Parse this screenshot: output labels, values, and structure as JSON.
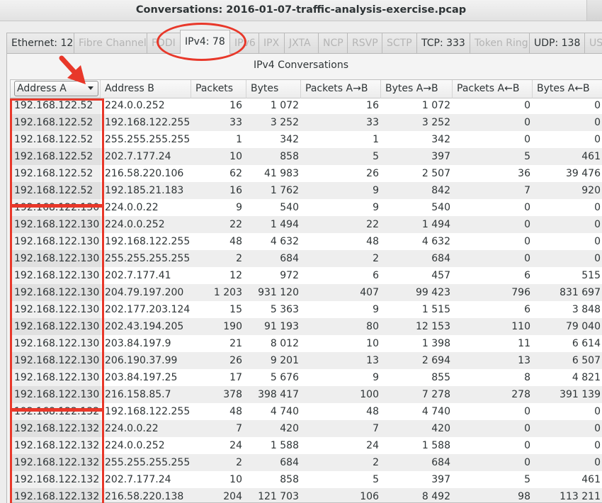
{
  "window": {
    "title": "Conversations: 2016-01-07-traffic-analysis-exercise.pcap"
  },
  "tabs": [
    {
      "label": "Ethernet: 12",
      "state": "enabled"
    },
    {
      "label": "Fibre Channel",
      "state": "disabled"
    },
    {
      "label": "FDDI",
      "state": "disabled"
    },
    {
      "label": "IPv4: 78",
      "state": "active"
    },
    {
      "label": "IPv6",
      "state": "disabled"
    },
    {
      "label": "IPX",
      "state": "disabled"
    },
    {
      "label": "JXTA",
      "state": "disabled"
    },
    {
      "label": "NCP",
      "state": "disabled"
    },
    {
      "label": "RSVP",
      "state": "disabled"
    },
    {
      "label": "SCTP",
      "state": "disabled"
    },
    {
      "label": "TCP: 333",
      "state": "enabled"
    },
    {
      "label": "Token Ring",
      "state": "disabled"
    },
    {
      "label": "UDP: 138",
      "state": "enabled"
    },
    {
      "label": "USB",
      "state": "disabled"
    }
  ],
  "section_title": "IPv4 Conversations",
  "columns": [
    "Address A",
    "Address B",
    "Packets",
    "Bytes",
    "Packets A→B",
    "Bytes A→B",
    "Packets A←B",
    "Bytes A←B"
  ],
  "rows": [
    [
      "192.168.122.52",
      "224.0.0.252",
      "16",
      "1 072",
      "16",
      "1 072",
      "0",
      "0"
    ],
    [
      "192.168.122.52",
      "192.168.122.255",
      "33",
      "3 252",
      "33",
      "3 252",
      "0",
      "0"
    ],
    [
      "192.168.122.52",
      "255.255.255.255",
      "1",
      "342",
      "1",
      "342",
      "0",
      "0"
    ],
    [
      "192.168.122.52",
      "202.7.177.24",
      "10",
      "858",
      "5",
      "397",
      "5",
      "461"
    ],
    [
      "192.168.122.52",
      "216.58.220.106",
      "62",
      "41 983",
      "26",
      "2 507",
      "36",
      "39 476"
    ],
    [
      "192.168.122.52",
      "192.185.21.183",
      "16",
      "1 762",
      "9",
      "842",
      "7",
      "920"
    ],
    [
      "192.168.122.130",
      "224.0.0.22",
      "9",
      "540",
      "9",
      "540",
      "0",
      "0"
    ],
    [
      "192.168.122.130",
      "224.0.0.252",
      "22",
      "1 494",
      "22",
      "1 494",
      "0",
      "0"
    ],
    [
      "192.168.122.130",
      "192.168.122.255",
      "48",
      "4 632",
      "48",
      "4 632",
      "0",
      "0"
    ],
    [
      "192.168.122.130",
      "255.255.255.255",
      "2",
      "684",
      "2",
      "684",
      "0",
      "0"
    ],
    [
      "192.168.122.130",
      "202.7.177.41",
      "12",
      "972",
      "6",
      "457",
      "6",
      "515"
    ],
    [
      "192.168.122.130",
      "204.79.197.200",
      "1 203",
      "931 120",
      "407",
      "99 423",
      "796",
      "831 697"
    ],
    [
      "192.168.122.130",
      "202.177.203.124",
      "15",
      "5 363",
      "9",
      "1 515",
      "6",
      "3 848"
    ],
    [
      "192.168.122.130",
      "202.43.194.205",
      "190",
      "91 193",
      "80",
      "12 153",
      "110",
      "79 040"
    ],
    [
      "192.168.122.130",
      "203.84.197.9",
      "21",
      "8 012",
      "10",
      "1 398",
      "11",
      "6 614"
    ],
    [
      "192.168.122.130",
      "206.190.37.99",
      "26",
      "9 201",
      "13",
      "2 694",
      "13",
      "6 507"
    ],
    [
      "192.168.122.130",
      "203.84.197.25",
      "17",
      "5 676",
      "9",
      "855",
      "8",
      "4 821"
    ],
    [
      "192.168.122.130",
      "216.158.85.7",
      "378",
      "398 417",
      "100",
      "7 278",
      "278",
      "391 139"
    ],
    [
      "192.168.122.132",
      "192.168.122.255",
      "48",
      "4 740",
      "48",
      "4 740",
      "0",
      "0"
    ],
    [
      "192.168.122.132",
      "224.0.0.22",
      "7",
      "420",
      "7",
      "420",
      "0",
      "0"
    ],
    [
      "192.168.122.132",
      "224.0.0.252",
      "24",
      "1 588",
      "24",
      "1 588",
      "0",
      "0"
    ],
    [
      "192.168.122.132",
      "255.255.255.255",
      "2",
      "684",
      "2",
      "684",
      "0",
      "0"
    ],
    [
      "192.168.122.132",
      "202.7.177.24",
      "10",
      "858",
      "5",
      "397",
      "5",
      "461"
    ],
    [
      "192.168.122.132",
      "216.58.220.138",
      "204",
      "121 703",
      "106",
      "8 492",
      "98",
      "113 211"
    ]
  ],
  "annotation_color": "#e8382a"
}
